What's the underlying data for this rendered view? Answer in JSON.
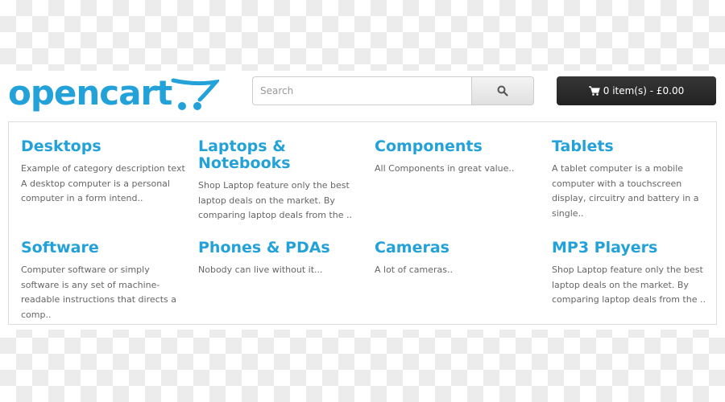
{
  "header": {
    "logo_text": "opencart",
    "search": {
      "placeholder": "Search",
      "value": "",
      "icon": "search-icon"
    },
    "cart": {
      "label": "0 item(s) - £0.00",
      "icon": "shopping-cart-icon"
    }
  },
  "colors": {
    "brand": "#23a1d9",
    "cart_bg": "#2a2a2a"
  },
  "categories": [
    {
      "title": "Desktops",
      "description": "Example of category description text A desktop computer is a personal computer in a form intend.."
    },
    {
      "title": "Laptops & Notebooks",
      "description": "Shop Laptop feature only the best laptop deals on the market. By comparing laptop deals from the .."
    },
    {
      "title": "Components",
      "description": "All Components in great value.."
    },
    {
      "title": "Tablets",
      "description": "A tablet computer is a mobile computer with a touchscreen display, circuitry and battery in a single.."
    },
    {
      "title": "Software",
      "description": "Computer software or simply software is any set of machine-readable instructions that directs a comp.."
    },
    {
      "title": "Phones & PDAs",
      "description": "Nobody can live without it..."
    },
    {
      "title": "Cameras",
      "description": "A lot of cameras.."
    },
    {
      "title": "MP3 Players",
      "description": "Shop Laptop feature only the best laptop deals on the market. By comparing laptop deals from the .."
    }
  ]
}
